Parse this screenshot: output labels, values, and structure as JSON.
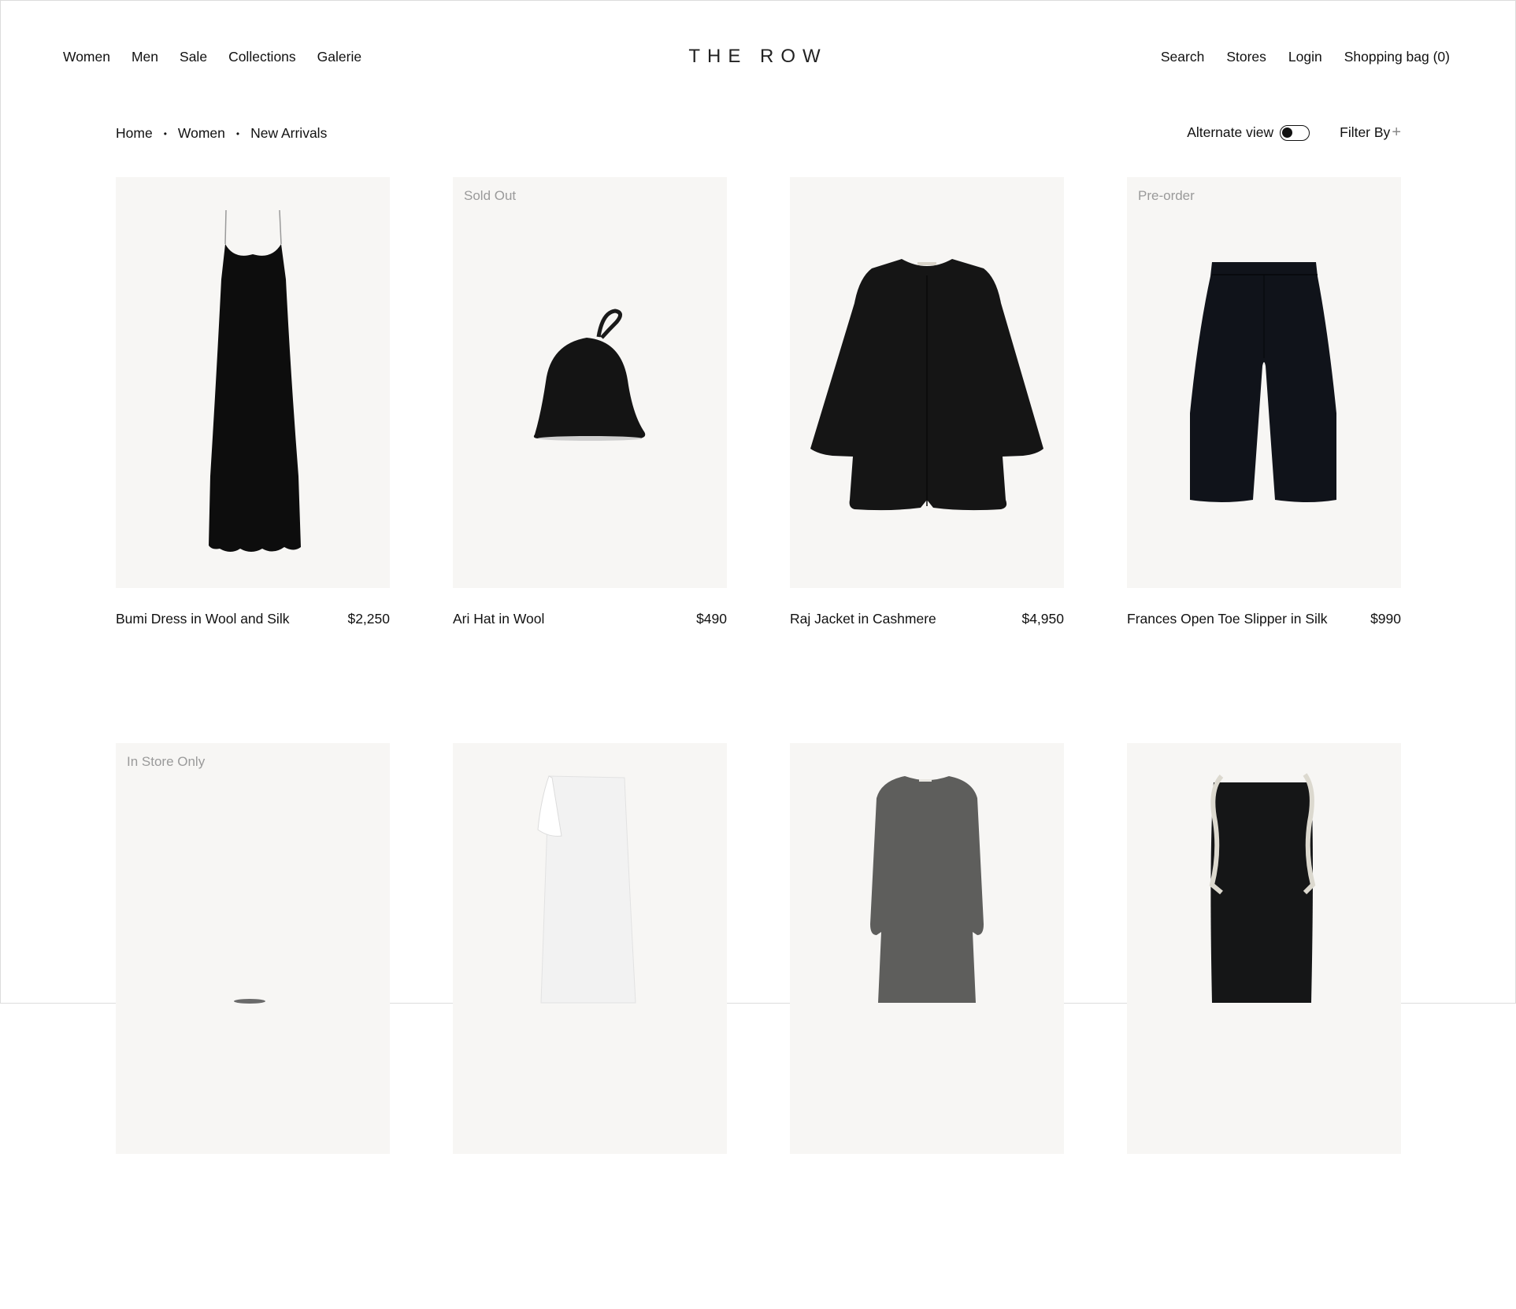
{
  "header": {
    "nav_left": [
      "Women",
      "Men",
      "Sale",
      "Collections",
      "Galerie"
    ],
    "logo": "THE ROW",
    "nav_right": [
      "Search",
      "Stores",
      "Login",
      "Shopping bag (0)"
    ]
  },
  "breadcrumb": [
    "Home",
    "Women",
    "New Arrivals"
  ],
  "toolbar": {
    "alternate_view_label": "Alternate view",
    "alternate_view_on": false,
    "filter_label": "Filter By"
  },
  "products": [
    {
      "name": "Bumi Dress in Wool and Silk",
      "price": "$2,250",
      "badge": ""
    },
    {
      "name": "Ari Hat in Wool",
      "price": "$490",
      "badge": "Sold Out"
    },
    {
      "name": "Raj Jacket in Cashmere",
      "price": "$4,950",
      "badge": ""
    },
    {
      "name": "Frances Open Toe Slipper in Silk",
      "price": "$990",
      "badge": "Pre-order"
    },
    {
      "name": "",
      "price": "",
      "badge": "In Store Only"
    },
    {
      "name": "",
      "price": "",
      "badge": ""
    },
    {
      "name": "",
      "price": "",
      "badge": ""
    },
    {
      "name": "",
      "price": "",
      "badge": ""
    }
  ],
  "icons": {
    "filter": "plus-icon",
    "separator": "dot-separator-icon"
  },
  "colors": {
    "background": "#ffffff",
    "card_background": "#f7f6f4",
    "text": "#111111",
    "badge_text": "#9a9a9a"
  }
}
